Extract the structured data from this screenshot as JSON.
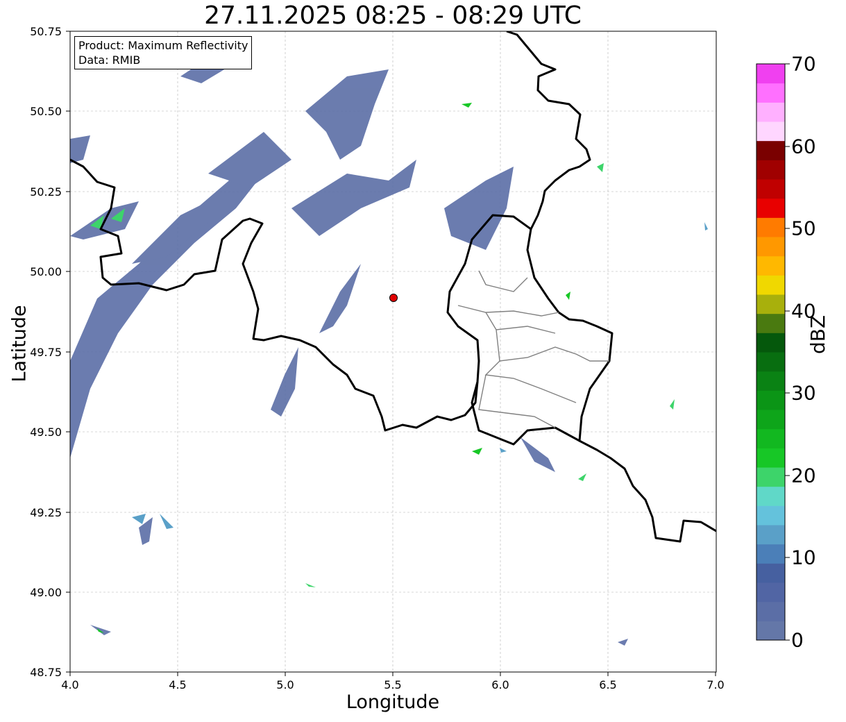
{
  "title": "27.11.2025 08:25 - 08:29 UTC",
  "xlabel": "Longitude",
  "ylabel": "Latitude",
  "info_box": {
    "line1": "Product: Maximum Reflectivity",
    "line2": "Data: RMIB"
  },
  "x_ticks": [
    "4.0",
    "4.5",
    "5.0",
    "5.5",
    "6.0",
    "6.5",
    "7.0"
  ],
  "y_ticks": [
    "50.75",
    "50.50",
    "50.25",
    "50.00",
    "49.75",
    "49.50",
    "49.25",
    "49.00",
    "48.75"
  ],
  "map": {
    "lon_range": [
      4.0,
      7.0
    ],
    "lat_range": [
      48.75,
      50.75
    ],
    "grid": true,
    "radar_site": {
      "lon": 5.505,
      "lat": 49.914,
      "color": "#e00000"
    }
  },
  "colorbar": {
    "label": "dBZ",
    "ticks": [
      "0",
      "10",
      "20",
      "30",
      "40",
      "50",
      "60",
      "70"
    ],
    "range": [
      0,
      70
    ],
    "colors": [
      "#6477a8",
      "#5b6ea6",
      "#5165a4",
      "#4660a0",
      "#4b7fb8",
      "#5aa0c8",
      "#64c2dc",
      "#60d8c8",
      "#3dd46a",
      "#17c726",
      "#12b820",
      "#0ea51a",
      "#0b9516",
      "#0a8214",
      "#086e10",
      "#05580c",
      "#4a7a10",
      "#a8b00c",
      "#f0d800",
      "#ffb800",
      "#ff9800",
      "#ff7b00",
      "#e80000",
      "#c00000",
      "#a00000",
      "#7a0000",
      "#ffd6ff",
      "#ffb0ff",
      "#ff70ff",
      "#f040f0"
    ]
  }
}
